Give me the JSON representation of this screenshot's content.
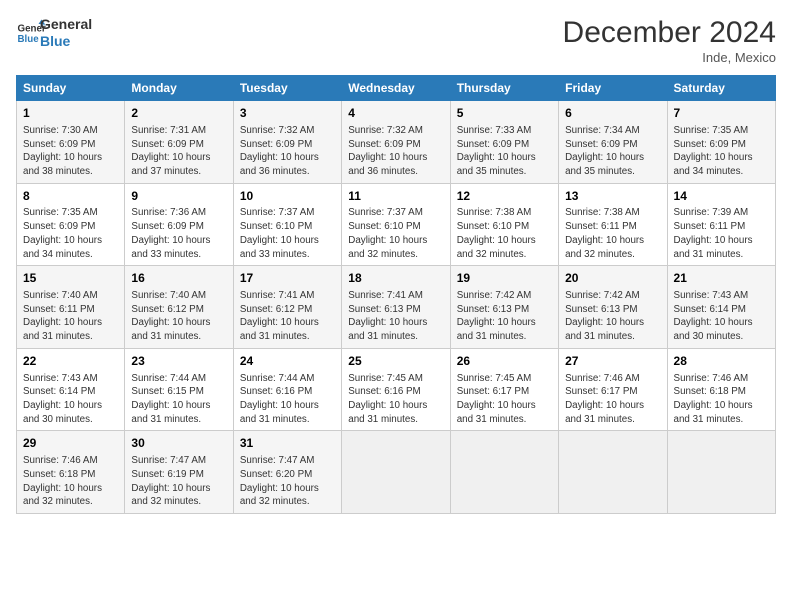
{
  "logo": {
    "line1": "General",
    "line2": "Blue"
  },
  "title": "December 2024",
  "location": "Inde, Mexico",
  "days_of_week": [
    "Sunday",
    "Monday",
    "Tuesday",
    "Wednesday",
    "Thursday",
    "Friday",
    "Saturday"
  ],
  "weeks": [
    [
      {
        "day": "1",
        "info": "Sunrise: 7:30 AM\nSunset: 6:09 PM\nDaylight: 10 hours\nand 38 minutes."
      },
      {
        "day": "2",
        "info": "Sunrise: 7:31 AM\nSunset: 6:09 PM\nDaylight: 10 hours\nand 37 minutes."
      },
      {
        "day": "3",
        "info": "Sunrise: 7:32 AM\nSunset: 6:09 PM\nDaylight: 10 hours\nand 36 minutes."
      },
      {
        "day": "4",
        "info": "Sunrise: 7:32 AM\nSunset: 6:09 PM\nDaylight: 10 hours\nand 36 minutes."
      },
      {
        "day": "5",
        "info": "Sunrise: 7:33 AM\nSunset: 6:09 PM\nDaylight: 10 hours\nand 35 minutes."
      },
      {
        "day": "6",
        "info": "Sunrise: 7:34 AM\nSunset: 6:09 PM\nDaylight: 10 hours\nand 35 minutes."
      },
      {
        "day": "7",
        "info": "Sunrise: 7:35 AM\nSunset: 6:09 PM\nDaylight: 10 hours\nand 34 minutes."
      }
    ],
    [
      {
        "day": "8",
        "info": "Sunrise: 7:35 AM\nSunset: 6:09 PM\nDaylight: 10 hours\nand 34 minutes."
      },
      {
        "day": "9",
        "info": "Sunrise: 7:36 AM\nSunset: 6:09 PM\nDaylight: 10 hours\nand 33 minutes."
      },
      {
        "day": "10",
        "info": "Sunrise: 7:37 AM\nSunset: 6:10 PM\nDaylight: 10 hours\nand 33 minutes."
      },
      {
        "day": "11",
        "info": "Sunrise: 7:37 AM\nSunset: 6:10 PM\nDaylight: 10 hours\nand 32 minutes."
      },
      {
        "day": "12",
        "info": "Sunrise: 7:38 AM\nSunset: 6:10 PM\nDaylight: 10 hours\nand 32 minutes."
      },
      {
        "day": "13",
        "info": "Sunrise: 7:38 AM\nSunset: 6:11 PM\nDaylight: 10 hours\nand 32 minutes."
      },
      {
        "day": "14",
        "info": "Sunrise: 7:39 AM\nSunset: 6:11 PM\nDaylight: 10 hours\nand 31 minutes."
      }
    ],
    [
      {
        "day": "15",
        "info": "Sunrise: 7:40 AM\nSunset: 6:11 PM\nDaylight: 10 hours\nand 31 minutes."
      },
      {
        "day": "16",
        "info": "Sunrise: 7:40 AM\nSunset: 6:12 PM\nDaylight: 10 hours\nand 31 minutes."
      },
      {
        "day": "17",
        "info": "Sunrise: 7:41 AM\nSunset: 6:12 PM\nDaylight: 10 hours\nand 31 minutes."
      },
      {
        "day": "18",
        "info": "Sunrise: 7:41 AM\nSunset: 6:13 PM\nDaylight: 10 hours\nand 31 minutes."
      },
      {
        "day": "19",
        "info": "Sunrise: 7:42 AM\nSunset: 6:13 PM\nDaylight: 10 hours\nand 31 minutes."
      },
      {
        "day": "20",
        "info": "Sunrise: 7:42 AM\nSunset: 6:13 PM\nDaylight: 10 hours\nand 31 minutes."
      },
      {
        "day": "21",
        "info": "Sunrise: 7:43 AM\nSunset: 6:14 PM\nDaylight: 10 hours\nand 30 minutes."
      }
    ],
    [
      {
        "day": "22",
        "info": "Sunrise: 7:43 AM\nSunset: 6:14 PM\nDaylight: 10 hours\nand 30 minutes."
      },
      {
        "day": "23",
        "info": "Sunrise: 7:44 AM\nSunset: 6:15 PM\nDaylight: 10 hours\nand 31 minutes."
      },
      {
        "day": "24",
        "info": "Sunrise: 7:44 AM\nSunset: 6:16 PM\nDaylight: 10 hours\nand 31 minutes."
      },
      {
        "day": "25",
        "info": "Sunrise: 7:45 AM\nSunset: 6:16 PM\nDaylight: 10 hours\nand 31 minutes."
      },
      {
        "day": "26",
        "info": "Sunrise: 7:45 AM\nSunset: 6:17 PM\nDaylight: 10 hours\nand 31 minutes."
      },
      {
        "day": "27",
        "info": "Sunrise: 7:46 AM\nSunset: 6:17 PM\nDaylight: 10 hours\nand 31 minutes."
      },
      {
        "day": "28",
        "info": "Sunrise: 7:46 AM\nSunset: 6:18 PM\nDaylight: 10 hours\nand 31 minutes."
      }
    ],
    [
      {
        "day": "29",
        "info": "Sunrise: 7:46 AM\nSunset: 6:18 PM\nDaylight: 10 hours\nand 32 minutes."
      },
      {
        "day": "30",
        "info": "Sunrise: 7:47 AM\nSunset: 6:19 PM\nDaylight: 10 hours\nand 32 minutes."
      },
      {
        "day": "31",
        "info": "Sunrise: 7:47 AM\nSunset: 6:20 PM\nDaylight: 10 hours\nand 32 minutes."
      },
      {
        "day": "",
        "info": ""
      },
      {
        "day": "",
        "info": ""
      },
      {
        "day": "",
        "info": ""
      },
      {
        "day": "",
        "info": ""
      }
    ]
  ]
}
